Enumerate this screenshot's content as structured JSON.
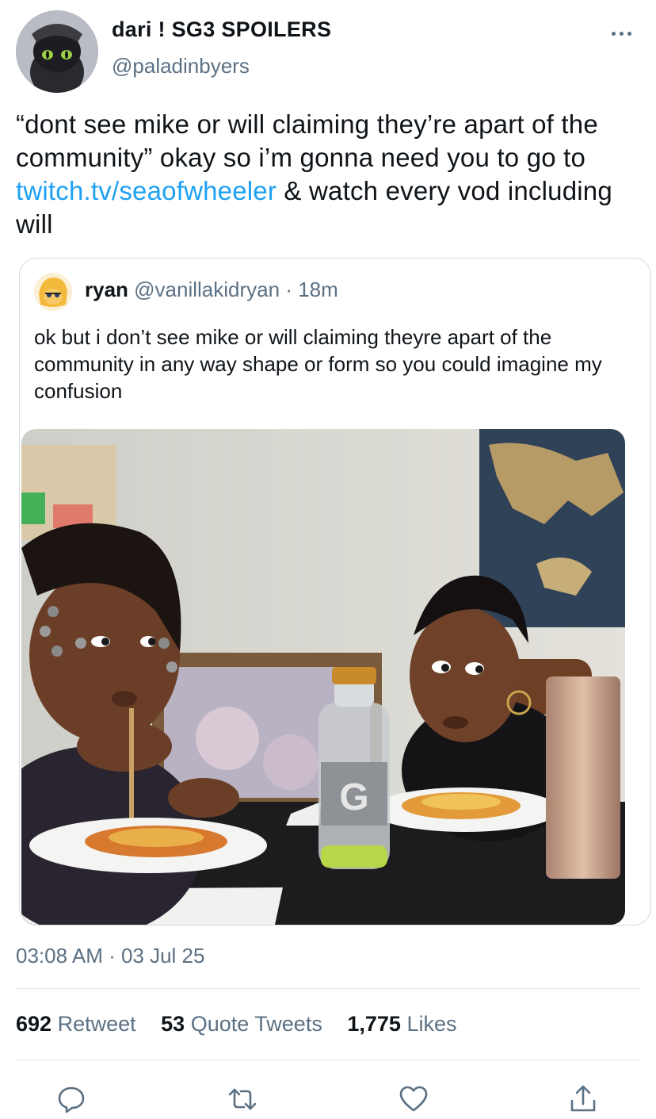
{
  "tweet": {
    "author": {
      "display_name": "dari ! SG3 SPOILERS",
      "handle": "@paladinbyers"
    },
    "text_before_link": "“dont see mike or will claiming they’re apart of the community” okay so i’m gonna need you to go to ",
    "link": "twitch.tv/seaofwheeler",
    "text_after_link": " & watch every vod including will",
    "timestamp": "03:08 AM · 03 Jul 25"
  },
  "quoted_tweet": {
    "author_name": "ryan",
    "author_handle": "@vanillakidryan",
    "time": "· 18m",
    "text": "ok but i don’t see mike or will claiming theyre apart of the community in any way shape or form so you could imagine my confusion"
  },
  "stats": {
    "retweets": {
      "count": "692",
      "label": "Retweet"
    },
    "quotes": {
      "count": "53",
      "label": "Quote Tweets"
    },
    "likes": {
      "count": "1,775",
      "label": "Likes"
    }
  },
  "icons": {
    "more": "more-horizontal-icon",
    "reply": "reply-icon",
    "retweet": "retweet-icon",
    "like": "heart-icon",
    "share": "share-icon"
  },
  "colors": {
    "link": "#1da1f2",
    "secondary_text": "#5b7083",
    "border": "#d6dce1"
  }
}
